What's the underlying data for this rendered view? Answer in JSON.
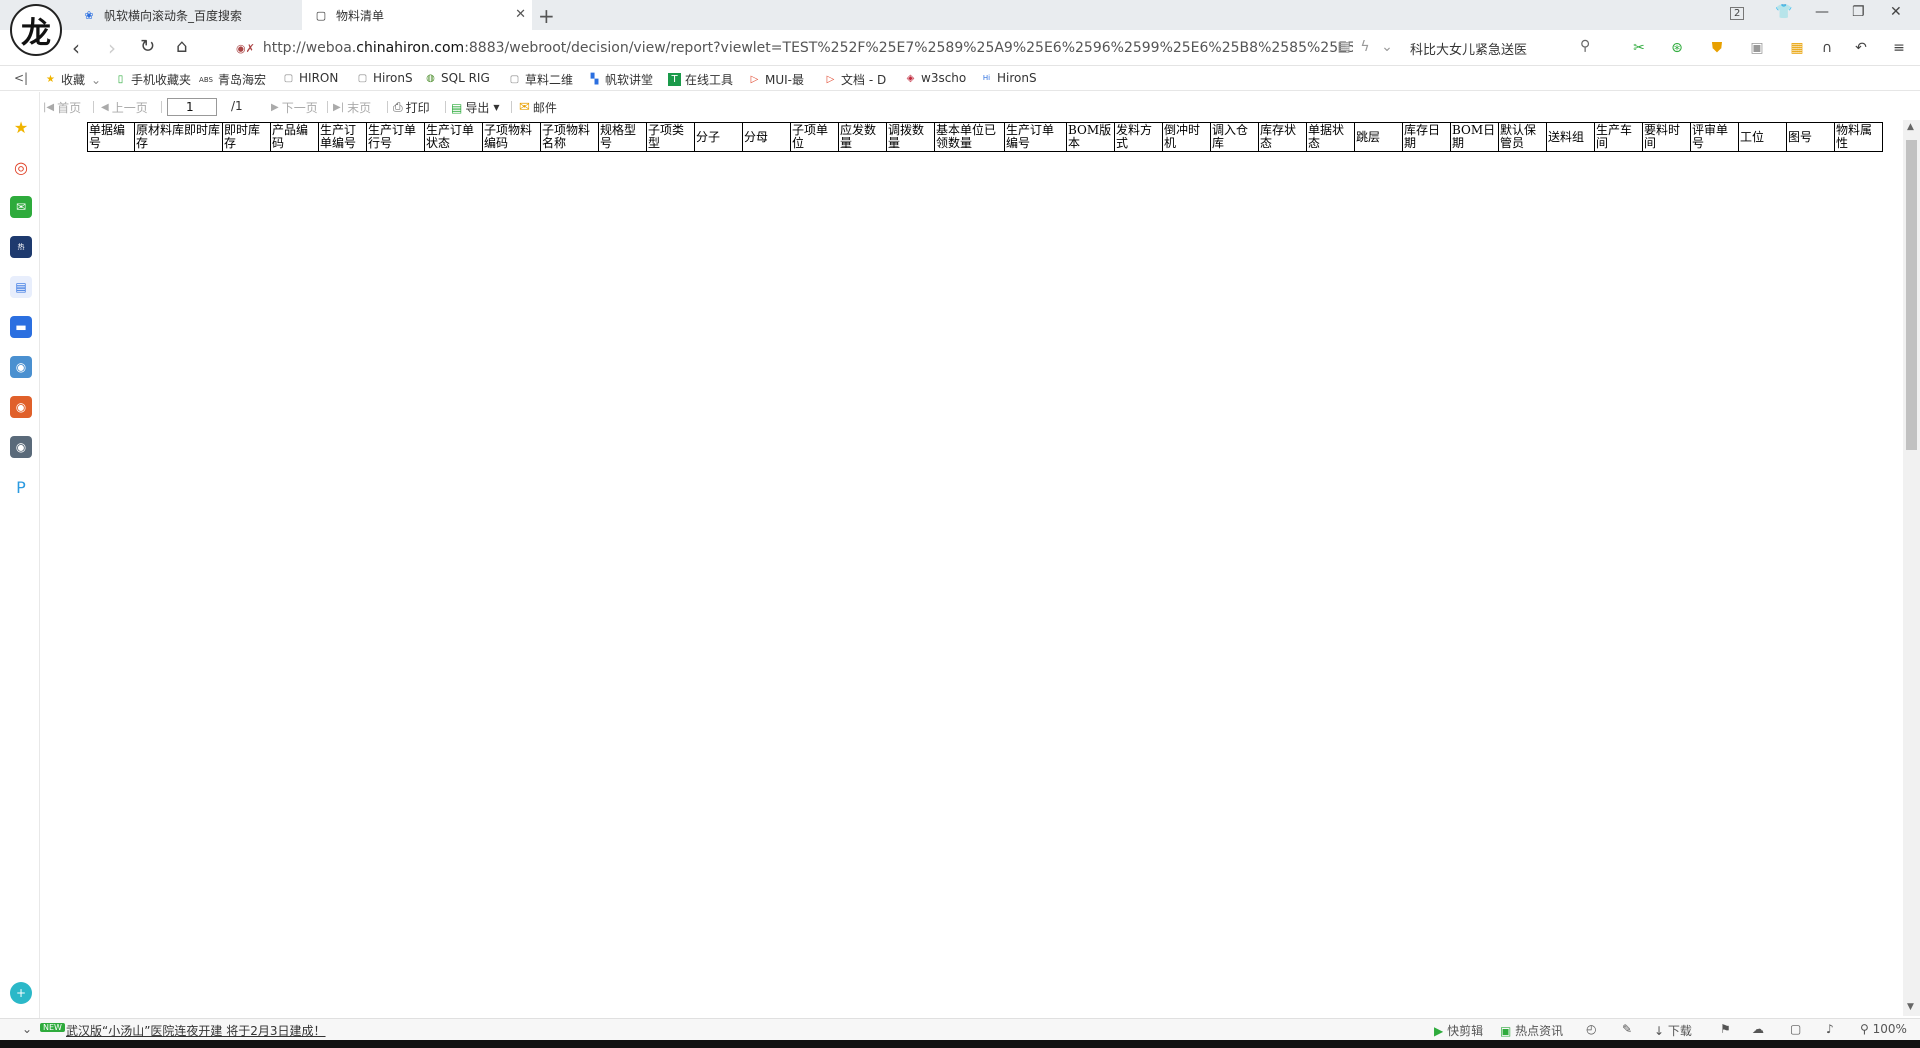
{
  "browser": {
    "tabs": [
      {
        "title": "帆软横向滚动条_百度搜索"
      },
      {
        "title": "物料清单"
      }
    ],
    "tab_count": "2",
    "url": {
      "prefix": "http://weboa.",
      "host": "chinahiron.com",
      "rest": ":8883/webroot/decision/view/report?viewlet=TEST%252F%25E7%2589%25A9%25E6%2596%2599%25E6%25B8%2585%25E5%25"
    },
    "search_text": "科比大女儿紧急送医"
  },
  "bookmarks": [
    {
      "label": "收藏",
      "icon": "star-icon"
    },
    {
      "label": "手机收藏夹",
      "icon": "phone-icon"
    },
    {
      "label": "青岛海宏",
      "icon": "abs-icon"
    },
    {
      "label": "HIRON",
      "icon": "page-icon"
    },
    {
      "label": "HironS",
      "icon": "page-icon"
    },
    {
      "label": "SQL RIG",
      "icon": "sql-icon"
    },
    {
      "label": "草料二维",
      "icon": "page-icon"
    },
    {
      "label": "帆软讲堂",
      "icon": "fanruan-icon"
    },
    {
      "label": "在线工具",
      "icon": "tool-icon"
    },
    {
      "label": "MUI-最",
      "icon": "mui-icon"
    },
    {
      "label": "文档 - D",
      "icon": "doc-icon"
    },
    {
      "label": "w3scho",
      "icon": "w3-icon"
    },
    {
      "label": "HironS",
      "icon": "hiron-icon"
    }
  ],
  "report_toolbar": {
    "first_page": "首页",
    "prev_page": "上一页",
    "page_value": "1",
    "page_total": "/1",
    "next_page": "下一页",
    "last_page": "末页",
    "print": "打印",
    "export": "导出",
    "mail": "邮件"
  },
  "table": {
    "columns": [
      "单据编号",
      "原材料库即时库存",
      "即时库存",
      "产品编码",
      "生产订单编号",
      "生产订单行号",
      "生产订单状态",
      "子项物料编码",
      "子项物料名称",
      "规格型号",
      "子项类型",
      "分子",
      "分母",
      "子项单位",
      "应发数量",
      "调拨数量",
      "基本单位已领数量",
      "生产订单编号",
      "BOM版本",
      "发料方式",
      "倒冲时机",
      "调入仓库",
      "库存状态",
      "单据状态",
      "跳层",
      "库存日期",
      "BOM日期",
      "默认保管员",
      "送料组",
      "生产车间",
      "要料时间",
      "评审单号",
      "工位",
      "图号",
      "物料属性"
    ]
  },
  "statusbar": {
    "news_badge": "NEW",
    "news": "武汉版“小汤山”医院连夜开建 将于2月3日建成！",
    "clip": "快剪辑",
    "hot": "热点资讯",
    "download": "下载",
    "zoom": "100%"
  },
  "colors": {
    "accent": "#2b6fe0",
    "news_green": "#2eab3c"
  }
}
